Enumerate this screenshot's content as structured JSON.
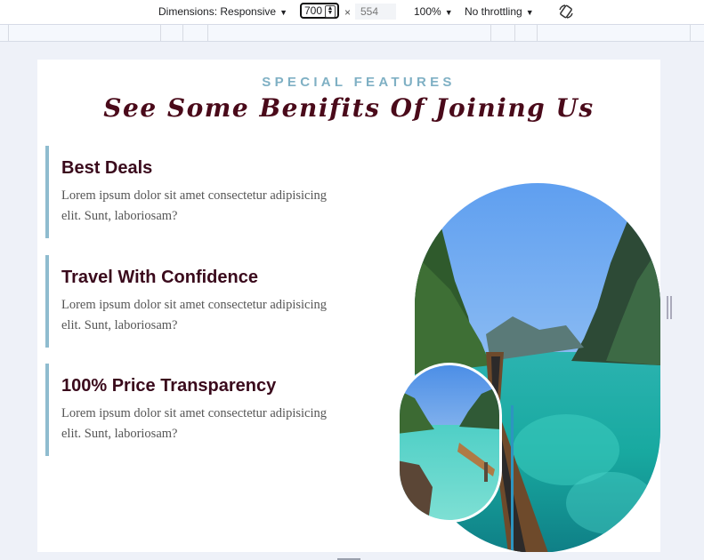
{
  "devtools": {
    "dimensions_label": "Dimensions: Responsive",
    "width_value": "700",
    "times_symbol": "×",
    "height_placeholder": "554",
    "zoom_label": "100%",
    "throttle_label": "No throttling"
  },
  "page": {
    "eyebrow": "SPECIAL FEATURES",
    "headline": "See Some Benifits Of Joining Us",
    "features": [
      {
        "title": "Best Deals",
        "text": "Lorem ipsum dolor sit amet consectetur adipisicing elit. Sunt, laboriosam?"
      },
      {
        "title": "Travel With Confidence",
        "text": "Lorem ipsum dolor sit amet consectetur adipisicing elit. Sunt, laboriosam?"
      },
      {
        "title": "100% Price Transparency",
        "text": "Lorem ipsum dolor sit amet consectetur adipisicing elit. Sunt, laboriosam?"
      }
    ]
  },
  "colors": {
    "accent_blue": "#8fbccf",
    "heading_maroon": "#3a0a1c",
    "eyebrow_blue": "#7fb0c4"
  },
  "icons": {
    "caret": "chevron-down-icon",
    "rotate": "rotate-icon"
  }
}
